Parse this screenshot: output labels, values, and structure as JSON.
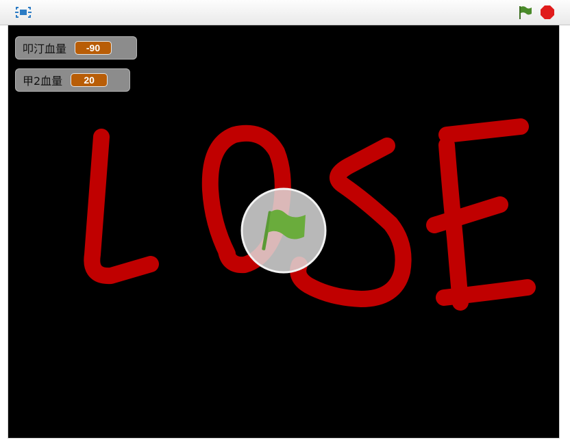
{
  "toolbar": {
    "fullscreen_icon": "fullscreen-icon",
    "green_flag_icon": "green-flag-icon",
    "stop_icon": "stop-icon",
    "colors": {
      "flag": "#4a8a2a",
      "stop": "#e01b1b"
    }
  },
  "stage": {
    "background": "#000000",
    "drawn_text": "LOSE",
    "drawn_color": "#c00000",
    "monitors": [
      {
        "label": "叩汀血量",
        "value": "-90"
      },
      {
        "label": "甲2血量",
        "value": "20"
      }
    ],
    "start_overlay_icon": "green-flag-icon"
  }
}
